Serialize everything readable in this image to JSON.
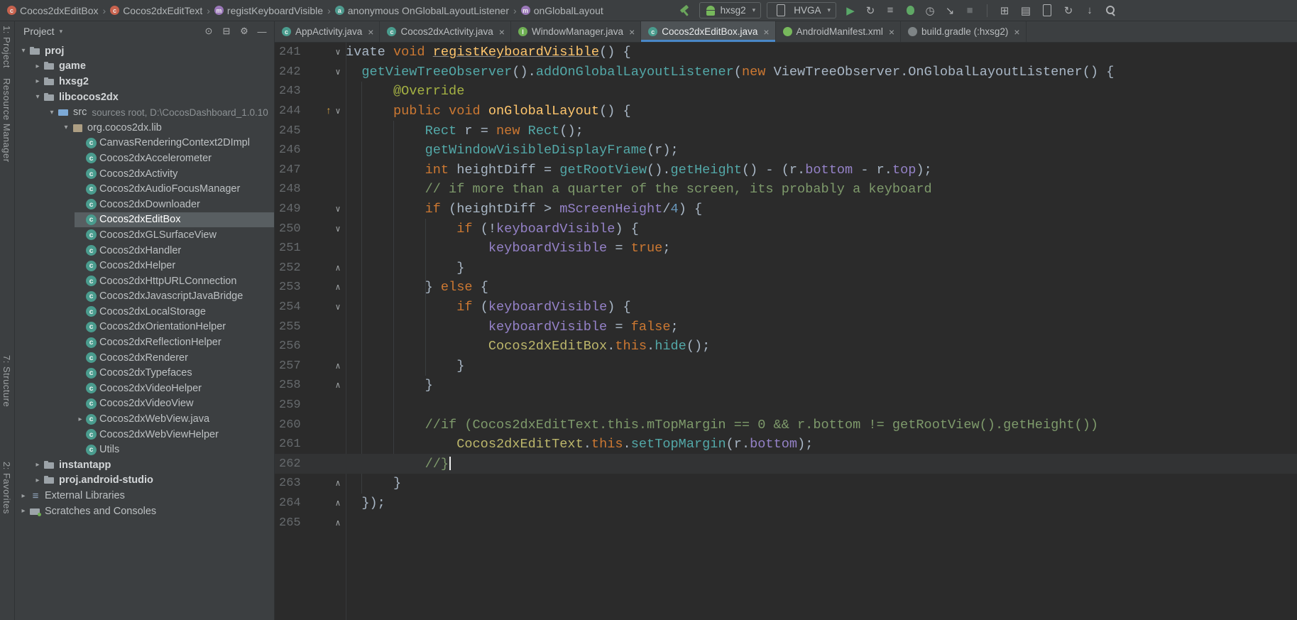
{
  "colors": {
    "chrome_bg": "#3C3F41",
    "editor_bg": "#2B2B2B",
    "accent": "#4A88C7",
    "tree_selection_bg": "#585E61",
    "caret_line_bg": "#323334",
    "run_green": "#59A869",
    "tokens": {
      "p": "#A9B7C6",
      "k": "#CC7832",
      "d": "#FFC66D",
      "du": "#FFC66D",
      "m": "#53A8A8",
      "f": "#9582C8",
      "n": "#6897BB",
      "c": "#7E9A6B",
      "cl": "#BDB76B",
      "a": "#A5B243"
    }
  },
  "icons": {
    "expand_down": "▾",
    "expand_right": "▸",
    "fold_down": "∨",
    "fold_up": "∧",
    "override": "↑",
    "close": "×",
    "combo_caret": "▾",
    "lib_glyph": "≡",
    "badge_letters": {
      "class": "c",
      "method": "m",
      "anon": "a",
      "interface": "I"
    }
  },
  "breadcrumb": {
    "separator": "›",
    "items": [
      {
        "icon": "class",
        "label": "Cocos2dxEditBox"
      },
      {
        "icon": "class",
        "label": "Cocos2dxEditText"
      },
      {
        "icon": "method",
        "label": "registKeyboardVisible"
      },
      {
        "icon": "anon",
        "label": "anonymous OnGlobalLayoutListener"
      },
      {
        "icon": "method",
        "label": "onGlobalLayout"
      }
    ]
  },
  "toolbar": {
    "build": {
      "name": "build-icon",
      "glyph": "build"
    },
    "module_selector": {
      "label": "hxsg2"
    },
    "device_selector": {
      "label": "HVGA"
    },
    "actions": [
      {
        "name": "run-button",
        "glyph": "▶",
        "color": "#59A869"
      },
      {
        "name": "apply-changes-icon",
        "glyph": "↻",
        "color": "#AFB1B3"
      },
      {
        "name": "run-configurations-icon",
        "glyph": "≡",
        "color": "#AFB1B3"
      },
      {
        "name": "debug-button",
        "glyph": "bug"
      },
      {
        "name": "profiler-button",
        "glyph": "◷",
        "color": "#AFB1B3"
      },
      {
        "name": "attach-debugger-icon",
        "glyph": "↘",
        "color": "#AFB1B3"
      },
      {
        "name": "stop-button",
        "glyph": "■",
        "color": "#666A6C"
      }
    ],
    "far_icons": [
      {
        "name": "layout-inspector-icon",
        "glyph": "⊞"
      },
      {
        "name": "logcat-icon",
        "glyph": "▤"
      },
      {
        "name": "device-manager-icon",
        "glyph": "phone"
      },
      {
        "name": "sync-project-icon",
        "glyph": "↻"
      },
      {
        "name": "sdk-manager-icon",
        "glyph": "↓"
      },
      {
        "name": "search-everywhere-icon",
        "glyph": "search"
      }
    ]
  },
  "tool_stripes": {
    "left": [
      {
        "name": "tool-stripe-project",
        "label": "1: Project"
      },
      {
        "name": "tool-stripe-resource-manager",
        "label": "Resource Manager"
      },
      {
        "name": "tool-stripe-structure",
        "label": "7: Structure"
      },
      {
        "name": "tool-stripe-favorites",
        "label": "2: Favorites"
      }
    ]
  },
  "project_panel": {
    "title": "Project",
    "header_icons": [
      {
        "name": "locate-file-icon",
        "glyph": "⊙"
      },
      {
        "name": "collapse-all-icon",
        "glyph": "⊟"
      },
      {
        "name": "settings-gear-icon",
        "glyph": "⚙"
      },
      {
        "name": "hide-panel-icon",
        "glyph": "―"
      }
    ],
    "tree": [
      {
        "label": "proj",
        "icon": "folder",
        "indent": 0,
        "arrow": "down",
        "bold": true
      },
      {
        "label": "game",
        "icon": "folder",
        "indent": 1,
        "arrow": "right",
        "bold": true
      },
      {
        "label": "hxsg2",
        "icon": "folder",
        "indent": 1,
        "arrow": "right",
        "bold": true
      },
      {
        "label": "libcocos2dx",
        "icon": "folder",
        "indent": 1,
        "arrow": "down",
        "bold": true
      },
      {
        "label": "src",
        "extra": "sources root, D:\\CocosDashboard_1.0.10",
        "icon": "src",
        "indent": 2,
        "arrow": "down"
      },
      {
        "label": "org.cocos2dx.lib",
        "icon": "package",
        "indent": 3,
        "arrow": "down"
      },
      {
        "label": "CanvasRenderingContext2DImpl",
        "icon": "class",
        "indent": 4
      },
      {
        "label": "Cocos2dxAccelerometer",
        "icon": "class",
        "indent": 4
      },
      {
        "label": "Cocos2dxActivity",
        "icon": "class",
        "indent": 4
      },
      {
        "label": "Cocos2dxAudioFocusManager",
        "icon": "class",
        "indent": 4
      },
      {
        "label": "Cocos2dxDownloader",
        "icon": "class",
        "indent": 4
      },
      {
        "label": "Cocos2dxEditBox",
        "icon": "class",
        "indent": 4,
        "selected": true
      },
      {
        "label": "Cocos2dxGLSurfaceView",
        "icon": "class",
        "indent": 4
      },
      {
        "label": "Cocos2dxHandler",
        "icon": "class",
        "indent": 4
      },
      {
        "label": "Cocos2dxHelper",
        "icon": "class",
        "indent": 4
      },
      {
        "label": "Cocos2dxHttpURLConnection",
        "icon": "class",
        "indent": 4
      },
      {
        "label": "Cocos2dxJavascriptJavaBridge",
        "icon": "class",
        "indent": 4
      },
      {
        "label": "Cocos2dxLocalStorage",
        "icon": "class",
        "indent": 4
      },
      {
        "label": "Cocos2dxOrientationHelper",
        "icon": "class",
        "indent": 4
      },
      {
        "label": "Cocos2dxReflectionHelper",
        "icon": "class",
        "indent": 4
      },
      {
        "label": "Cocos2dxRenderer",
        "icon": "class",
        "indent": 4
      },
      {
        "label": "Cocos2dxTypefaces",
        "icon": "class",
        "indent": 4
      },
      {
        "label": "Cocos2dxVideoHelper",
        "icon": "class",
        "indent": 4
      },
      {
        "label": "Cocos2dxVideoView",
        "icon": "class",
        "indent": 4
      },
      {
        "label": "Cocos2dxWebView.java",
        "icon": "class",
        "indent": 4,
        "arrow": "right"
      },
      {
        "label": "Cocos2dxWebViewHelper",
        "icon": "class",
        "indent": 4
      },
      {
        "label": "Utils",
        "icon": "class",
        "indent": 4
      },
      {
        "label": "instantapp",
        "icon": "folder",
        "indent": 1,
        "arrow": "right",
        "bold": true
      },
      {
        "label": "proj.android-studio",
        "icon": "folder",
        "indent": 1,
        "arrow": "right",
        "bold": true
      },
      {
        "label": "External Libraries",
        "icon": "lib",
        "indent": 0,
        "arrow": "right"
      },
      {
        "label": "Scratches and Consoles",
        "icon": "scratch",
        "indent": 0,
        "arrow": "right"
      }
    ]
  },
  "editor": {
    "tabs": [
      {
        "icon": "class",
        "label": "AppActivity.java"
      },
      {
        "icon": "class",
        "label": "Cocos2dxActivity.java"
      },
      {
        "icon": "interface",
        "label": "WindowManager.java"
      },
      {
        "icon": "class",
        "label": "Cocos2dxEditBox.java",
        "active": true
      },
      {
        "icon": "android",
        "label": "AndroidManifest.xml"
      },
      {
        "icon": "gradle",
        "label": "build.gradle (:hxsg2)"
      }
    ],
    "first_line": 241,
    "indent_guides": [
      {
        "col": 2,
        "from": 243,
        "to": 264
      },
      {
        "col": 6,
        "from": 245,
        "to": 263
      },
      {
        "col": 10,
        "from": 250,
        "to": 258
      }
    ],
    "lines": [
      {
        "n": 241,
        "ind": 0,
        "fold": "d",
        "seg": [
          [
            "p",
            "ivate "
          ],
          [
            "k",
            "void "
          ],
          [
            "du",
            "registKeyboardVisible"
          ],
          [
            "p",
            "() {"
          ]
        ]
      },
      {
        "n": 242,
        "ind": 2,
        "fold": "d",
        "seg": [
          [
            "m",
            "getViewTreeObserver"
          ],
          [
            "p",
            "()."
          ],
          [
            "m",
            "addOnGlobalLayoutListener"
          ],
          [
            "p",
            "("
          ],
          [
            "k",
            "new "
          ],
          [
            "p",
            "ViewTreeObserver.OnGlobalLayoutListener() {"
          ]
        ]
      },
      {
        "n": 243,
        "ind": 6,
        "fold": "",
        "seg": [
          [
            "a",
            "@Override"
          ]
        ]
      },
      {
        "n": 244,
        "ind": 6,
        "fold": "d",
        "ovr": true,
        "seg": [
          [
            "k",
            "public void "
          ],
          [
            "d",
            "onGlobalLayout"
          ],
          [
            "p",
            "() {"
          ]
        ]
      },
      {
        "n": 245,
        "ind": 10,
        "fold": "",
        "seg": [
          [
            "m",
            "Rect "
          ],
          [
            "p",
            "r = "
          ],
          [
            "k",
            "new "
          ],
          [
            "m",
            "Rect"
          ],
          [
            "p",
            "();"
          ]
        ]
      },
      {
        "n": 246,
        "ind": 10,
        "fold": "",
        "seg": [
          [
            "m",
            "getWindowVisibleDisplayFrame"
          ],
          [
            "p",
            "(r);"
          ]
        ]
      },
      {
        "n": 247,
        "ind": 10,
        "fold": "",
        "seg": [
          [
            "k",
            "int "
          ],
          [
            "p",
            "heightDiff = "
          ],
          [
            "m",
            "getRootView"
          ],
          [
            "p",
            "()."
          ],
          [
            "m",
            "getHeight"
          ],
          [
            "p",
            "() - (r."
          ],
          [
            "f",
            "bottom"
          ],
          [
            "p",
            " - r."
          ],
          [
            "f",
            "top"
          ],
          [
            "p",
            ");"
          ]
        ]
      },
      {
        "n": 248,
        "ind": 10,
        "fold": "",
        "seg": [
          [
            "c",
            "// if more than a quarter of the screen, its probably a keyboard"
          ]
        ]
      },
      {
        "n": 249,
        "ind": 10,
        "fold": "d",
        "seg": [
          [
            "k",
            "if "
          ],
          [
            "p",
            "(heightDiff > "
          ],
          [
            "f",
            "mScreenHeight"
          ],
          [
            "p",
            "/"
          ],
          [
            "n",
            "4"
          ],
          [
            "p",
            ") {"
          ]
        ]
      },
      {
        "n": 250,
        "ind": 14,
        "fold": "d",
        "seg": [
          [
            "k",
            "if "
          ],
          [
            "p",
            "(!"
          ],
          [
            "f",
            "keyboardVisible"
          ],
          [
            "p",
            ") {"
          ]
        ]
      },
      {
        "n": 251,
        "ind": 18,
        "fold": "",
        "seg": [
          [
            "f",
            "keyboardVisible"
          ],
          [
            "p",
            " = "
          ],
          [
            "k",
            "true"
          ],
          [
            "p",
            ";"
          ]
        ]
      },
      {
        "n": 252,
        "ind": 14,
        "fold": "u",
        "seg": [
          [
            "p",
            "}"
          ]
        ]
      },
      {
        "n": 253,
        "ind": 10,
        "fold": "u",
        "seg": [
          [
            "p",
            "} "
          ],
          [
            "k",
            "else"
          ],
          [
            "p",
            " {"
          ]
        ]
      },
      {
        "n": 254,
        "ind": 14,
        "fold": "d",
        "seg": [
          [
            "k",
            "if "
          ],
          [
            "p",
            "("
          ],
          [
            "f",
            "keyboardVisible"
          ],
          [
            "p",
            ") {"
          ]
        ]
      },
      {
        "n": 255,
        "ind": 18,
        "fold": "",
        "seg": [
          [
            "f",
            "keyboardVisible"
          ],
          [
            "p",
            " = "
          ],
          [
            "k",
            "false"
          ],
          [
            "p",
            ";"
          ]
        ]
      },
      {
        "n": 256,
        "ind": 18,
        "fold": "",
        "seg": [
          [
            "cl",
            "Cocos2dxEditBox"
          ],
          [
            "p",
            "."
          ],
          [
            "k",
            "this"
          ],
          [
            "p",
            "."
          ],
          [
            "m",
            "hide"
          ],
          [
            "p",
            "();"
          ]
        ]
      },
      {
        "n": 257,
        "ind": 14,
        "fold": "u",
        "seg": [
          [
            "p",
            "}"
          ]
        ]
      },
      {
        "n": 258,
        "ind": 10,
        "fold": "u",
        "seg": [
          [
            "p",
            "}"
          ]
        ]
      },
      {
        "n": 259,
        "ind": 0,
        "fold": "",
        "seg": []
      },
      {
        "n": 260,
        "ind": 10,
        "fold": "",
        "seg": [
          [
            "c",
            "//if (Cocos2dxEditText.this.mTopMargin == 0 && r.bottom != getRootView().getHeight())"
          ]
        ]
      },
      {
        "n": 261,
        "ind": 14,
        "fold": "",
        "seg": [
          [
            "cl",
            "Cocos2dxEditText"
          ],
          [
            "p",
            "."
          ],
          [
            "k",
            "this"
          ],
          [
            "p",
            "."
          ],
          [
            "m",
            "setTopMargin"
          ],
          [
            "p",
            "(r."
          ],
          [
            "f",
            "bottom"
          ],
          [
            "p",
            ");"
          ]
        ]
      },
      {
        "n": 262,
        "ind": 10,
        "fold": "",
        "cur": true,
        "caret": true,
        "seg": [
          [
            "c",
            "//}"
          ]
        ]
      },
      {
        "n": 263,
        "ind": 6,
        "fold": "u",
        "seg": [
          [
            "p",
            "}"
          ]
        ]
      },
      {
        "n": 264,
        "ind": 2,
        "fold": "u",
        "seg": [
          [
            "p",
            "});"
          ]
        ]
      },
      {
        "n": 265,
        "ind": 0,
        "fold": "u",
        "seg": []
      }
    ]
  }
}
